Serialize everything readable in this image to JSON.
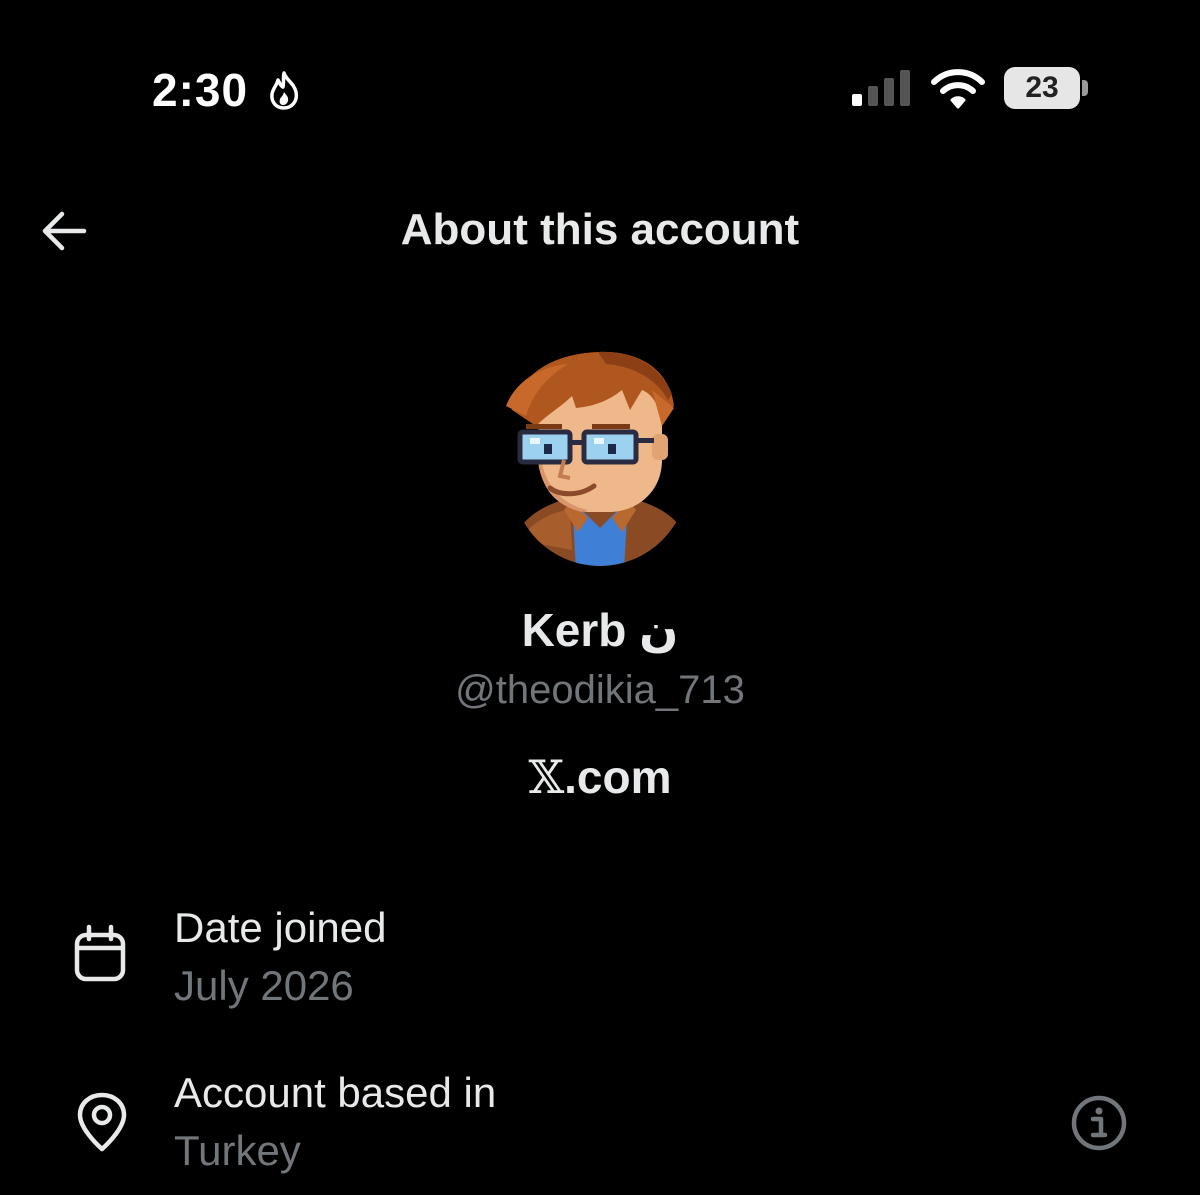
{
  "status_bar": {
    "time": "2:30",
    "battery_level": "23",
    "icons": [
      "flame-icon",
      "cellular-signal-icon",
      "wifi-icon",
      "battery-icon"
    ]
  },
  "header": {
    "title": "About this account",
    "back_icon": "arrow-left-icon"
  },
  "profile": {
    "display_name": "Kerb ن",
    "handle": "@theodikia_713",
    "platform_logo": "𝕏",
    "platform_suffix": ".com"
  },
  "info_rows": [
    {
      "icon": "calendar-icon",
      "label": "Date joined",
      "value": "July 2026"
    },
    {
      "icon": "location-pin-icon",
      "label": "Account based in",
      "value": "Turkey",
      "action_icon": "info-icon"
    }
  ],
  "colors": {
    "background": "#000000",
    "primary_text": "#e7e9ea",
    "secondary_text": "#71767b",
    "battery_fill": "#e6e6e6"
  }
}
